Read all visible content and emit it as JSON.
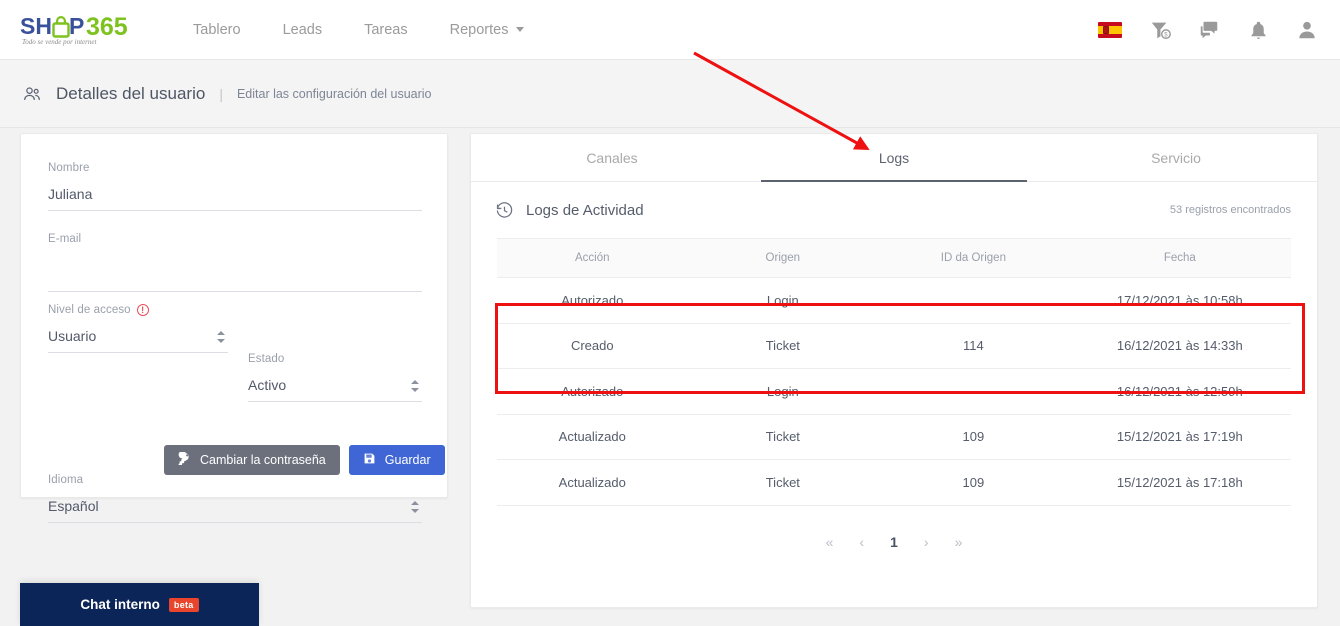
{
  "brand": {
    "name": "SHOP365",
    "part1": "SH",
    "part2": "P",
    "part3": "365",
    "tagline": "Todo se vende por internet",
    "color_dark": "#39519b",
    "color_green": "#7ec220"
  },
  "topnav": {
    "links": [
      {
        "label": "Tablero",
        "caret": false
      },
      {
        "label": "Leads",
        "caret": false
      },
      {
        "label": "Tareas",
        "caret": false
      },
      {
        "label": "Reportes",
        "caret": true
      }
    ],
    "icons": [
      {
        "name": "flag-spain-icon"
      },
      {
        "name": "funnel-money-icon"
      },
      {
        "name": "chat-bubbles-icon"
      },
      {
        "name": "bell-icon"
      },
      {
        "name": "user-avatar-icon"
      }
    ]
  },
  "breadcrumb": {
    "icon": "users-icon",
    "title": "Detalles del usuario",
    "separator": "|",
    "subtitle": "Editar las configuración del usuario"
  },
  "form": {
    "nombre": {
      "label": "Nombre",
      "value": "Juliana",
      "placeholder": ""
    },
    "email": {
      "label": "E-mail",
      "value": "",
      "placeholder": ""
    },
    "nivel_acceso": {
      "label": "Nivel de acceso",
      "value": "Usuario",
      "info_icon": "!"
    },
    "estado": {
      "label": "Estado",
      "value": "Activo"
    },
    "idioma": {
      "label": "Idioma",
      "value": "Español"
    },
    "buttons": {
      "change_password": "Cambiar la contraseña",
      "save": "Guardar"
    }
  },
  "panel": {
    "tabs": [
      {
        "label": "Canales",
        "active": false
      },
      {
        "label": "Logs",
        "active": true
      },
      {
        "label": "Servicio",
        "active": false
      }
    ],
    "icon": "history-clock-icon",
    "title": "Logs de Actividad",
    "count_text": "53 registros encontrados",
    "table": {
      "headers": [
        "Acción",
        "Origen",
        "ID da Origen",
        "Fecha"
      ],
      "rows": [
        {
          "accion": "Autorizado",
          "origen": "Login",
          "id": "",
          "fecha": "17/12/2021 às 10:58h"
        },
        {
          "accion": "Creado",
          "origen": "Ticket",
          "id": "114",
          "fecha": "16/12/2021 às 14:33h"
        },
        {
          "accion": "Autorizado",
          "origen": "Login",
          "id": "",
          "fecha": "16/12/2021 às 12:59h"
        },
        {
          "accion": "Actualizado",
          "origen": "Ticket",
          "id": "109",
          "fecha": "15/12/2021 às 17:19h"
        },
        {
          "accion": "Actualizado",
          "origen": "Ticket",
          "id": "109",
          "fecha": "15/12/2021 às 17:18h"
        }
      ]
    },
    "pagination": {
      "first": "«",
      "prev": "‹",
      "current": "1",
      "next": "›",
      "last": "»"
    }
  },
  "chat": {
    "label": "Chat interno",
    "badge": "beta",
    "background": "#0c2558"
  },
  "annotations": {
    "arrow_color": "#ee1111",
    "rect_color": "#ee1111"
  }
}
